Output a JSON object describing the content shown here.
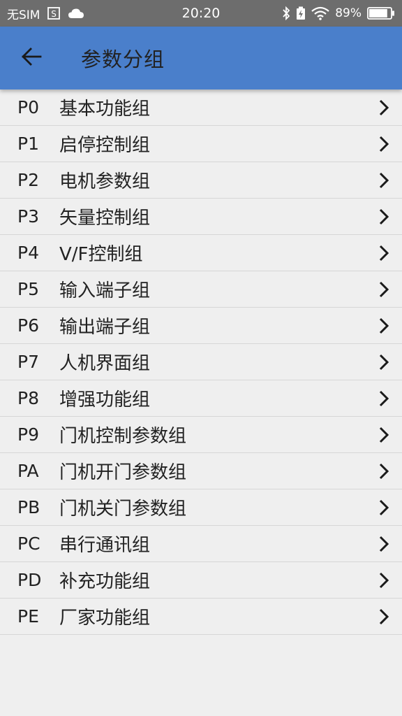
{
  "status_bar": {
    "carrier": "无SIM",
    "time": "20:20",
    "battery_percent": "89%",
    "battery_level": 0.89,
    "icons": [
      "sim-card-icon",
      "cloud-icon",
      "bluetooth-icon",
      "battery-saver-icon",
      "wifi-icon",
      "battery-icon"
    ]
  },
  "app_bar": {
    "title": "参数分组",
    "back_icon": "arrow-left-icon",
    "color": "#4a7fcb"
  },
  "groups": [
    {
      "code": "P0",
      "name": "基本功能组"
    },
    {
      "code": "P1",
      "name": "启停控制组"
    },
    {
      "code": "P2",
      "name": "电机参数组"
    },
    {
      "code": "P3",
      "name": "矢量控制组"
    },
    {
      "code": "P4",
      "name": "V/F控制组"
    },
    {
      "code": "P5",
      "name": "输入端子组"
    },
    {
      "code": "P6",
      "name": "输出端子组"
    },
    {
      "code": "P7",
      "name": "人机界面组"
    },
    {
      "code": "P8",
      "name": "增强功能组"
    },
    {
      "code": "P9",
      "name": "门机控制参数组"
    },
    {
      "code": "PA",
      "name": "门机开门参数组"
    },
    {
      "code": "PB",
      "name": "门机关门参数组"
    },
    {
      "code": "PC",
      "name": "串行通讯组"
    },
    {
      "code": "PD",
      "name": "补充功能组"
    },
    {
      "code": "PE",
      "name": "厂家功能组"
    }
  ]
}
